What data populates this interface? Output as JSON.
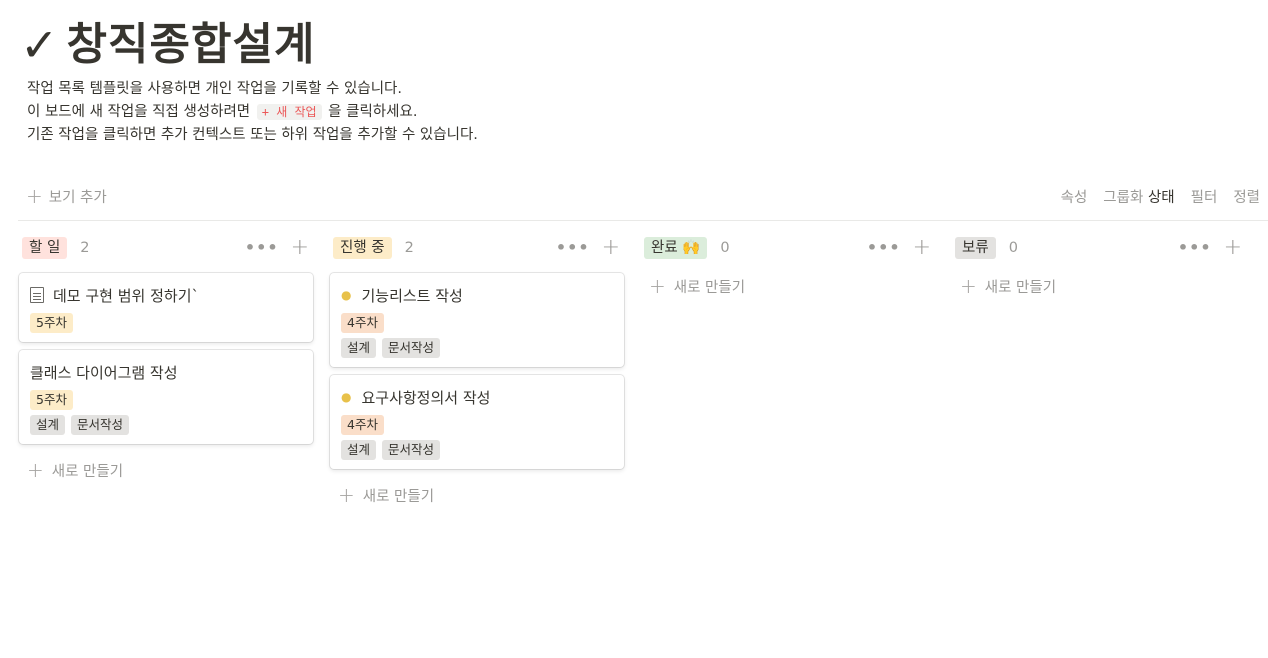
{
  "page": {
    "title": "창직종합설계",
    "title_icon": "check-mark-icon",
    "description": {
      "line1": "작업 목록 템플릿을 사용하면 개인 작업을 기록할 수 있습니다.",
      "line2_before": "이 보드에 새 작업을 직접 생성하려면",
      "line2_code": "+ 새 작업",
      "line2_after": "을 클릭하세요.",
      "line3": "기존 작업을 클릭하면 추가 컨텍스트 또는 하위 작업을 추가할 수 있습니다."
    }
  },
  "toolbar": {
    "add_view": "보기 추가",
    "properties": "속성",
    "group_label": "그룹화",
    "group_value": "상태",
    "filter": "필터",
    "sort": "정렬"
  },
  "columns": [
    {
      "status": "할 일",
      "count": "2",
      "color": "#ffe2dd",
      "new_label": "새로 만들기",
      "cards": [
        {
          "icon": "document-icon",
          "title": "데모 구현 범위 정하기`",
          "week": "5주차",
          "tags": []
        },
        {
          "icon": "",
          "title": "클래스 다이어그램 작성",
          "week": "5주차",
          "tags": [
            "설계",
            "문서작성"
          ]
        }
      ]
    },
    {
      "status": "진행 중",
      "count": "2",
      "color": "#fdecc8",
      "new_label": "새로 만들기",
      "cards": [
        {
          "icon": "lightbulb-icon",
          "title": "기능리스트 작성",
          "week": "4주차",
          "tags": [
            "설계",
            "문서작성"
          ]
        },
        {
          "icon": "lightbulb-icon",
          "title": "요구사항정의서 작성",
          "week": "4주차",
          "tags": [
            "설계",
            "문서작성"
          ]
        }
      ]
    },
    {
      "status": "완료 🙌",
      "count": "0",
      "color": "#dbeddb",
      "new_label": "새로 만들기",
      "cards": []
    },
    {
      "status": "보류",
      "count": "0",
      "color": "#e3e2e0",
      "new_label": "새로 만들기",
      "cards": []
    }
  ]
}
